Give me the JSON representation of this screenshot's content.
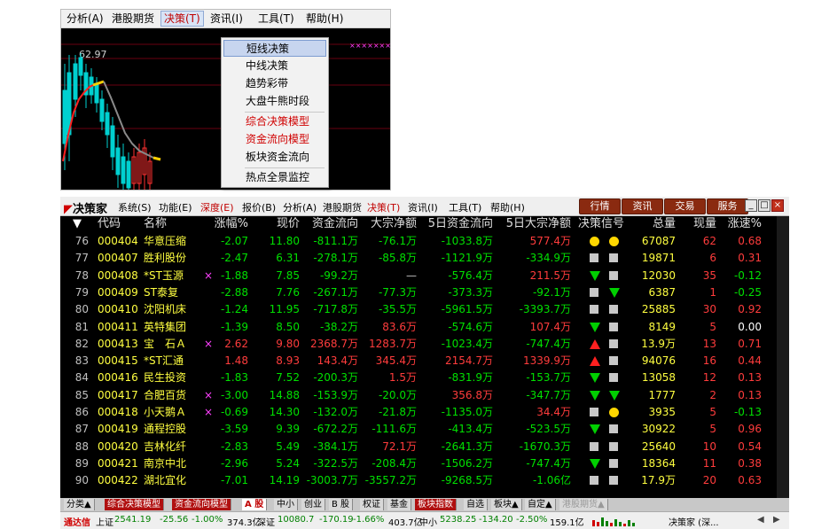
{
  "top_window": {
    "menu": [
      "分析(A)",
      "港股期货",
      "决策(T)",
      "资讯(I)",
      "工具(T)",
      "帮助(H)"
    ],
    "price_label": "62.97",
    "dropdown": [
      {
        "label": "短线决策"
      },
      {
        "label": "中线决策"
      },
      {
        "label": "趋势彩带"
      },
      {
        "label": "大盘牛熊时段"
      },
      {
        "label": "综合决策模型"
      },
      {
        "label": "资金流向模型"
      },
      {
        "label": "板块资金流向"
      },
      {
        "label": "热点全景监控"
      }
    ]
  },
  "main_window": {
    "logo": "决策家",
    "menu": [
      "系统(S)",
      "功能(E)",
      "深度(E)",
      "报价(B)",
      "分析(A)",
      "港股期货",
      "决策(T)",
      "资讯(I)",
      "工具(T)",
      "帮助(H)"
    ],
    "buttons": [
      "行情",
      "资讯",
      "交易",
      "服务"
    ],
    "window_controls": [
      "_",
      "□",
      "×"
    ],
    "headers": [
      "代码",
      "名称",
      "涨幅%",
      "现价",
      "资金流向",
      "大宗净额",
      "5日资金流向",
      "5日大宗净额",
      "决策信号",
      "总量",
      "现量",
      "涨速%"
    ],
    "rows": [
      {
        "no": "76",
        "code": "000404",
        "name": "华意压缩",
        "x": "",
        "chg": "-2.07",
        "price": "11.80",
        "flow": "-811.1万",
        "block": "-76.1万",
        "flow5": "-1033.8万",
        "block5": "577.4万",
        "sig": [
          "circ",
          "circ"
        ],
        "vol": "67087",
        "cur": "62",
        "spd": "0.68"
      },
      {
        "no": "77",
        "code": "000407",
        "name": "胜利股份",
        "x": "",
        "chg": "-2.47",
        "price": "6.31",
        "flow": "-278.1万",
        "block": "-85.8万",
        "flow5": "-1121.9万",
        "block5": "-334.9万",
        "sig": [
          "sq",
          "sq"
        ],
        "vol": "19871",
        "cur": "6",
        "spd": "0.31"
      },
      {
        "no": "78",
        "code": "000408",
        "name": "*ST玉源",
        "x": "×",
        "chg": "-1.88",
        "price": "7.85",
        "flow": "-99.2万",
        "block": "—",
        "flow5": "-576.4万",
        "block5": "211.5万",
        "sig": [
          "dn",
          "sq"
        ],
        "vol": "12030",
        "cur": "35",
        "spd": "-0.12"
      },
      {
        "no": "79",
        "code": "000409",
        "name": "ST泰复",
        "x": "",
        "chg": "-2.88",
        "price": "7.76",
        "flow": "-267.1万",
        "block": "-77.3万",
        "flow5": "-373.3万",
        "block5": "-92.1万",
        "sig": [
          "sq",
          "dn"
        ],
        "vol": "6387",
        "cur": "1",
        "spd": "-0.25"
      },
      {
        "no": "80",
        "code": "000410",
        "name": "沈阳机床",
        "x": "",
        "chg": "-1.24",
        "price": "11.95",
        "flow": "-717.8万",
        "block": "-35.5万",
        "flow5": "-5961.5万",
        "block5": "-3393.7万",
        "sig": [
          "sq",
          "sq"
        ],
        "vol": "25885",
        "cur": "30",
        "spd": "0.92"
      },
      {
        "no": "81",
        "code": "000411",
        "name": "英特集团",
        "x": "",
        "chg": "-1.39",
        "price": "8.50",
        "flow": "-38.2万",
        "block": "83.6万",
        "flow5": "-574.6万",
        "block5": "107.4万",
        "sig": [
          "dn",
          "sq"
        ],
        "vol": "8149",
        "cur": "5",
        "spd": "0.00"
      },
      {
        "no": "82",
        "code": "000413",
        "name": "宝　石Ａ",
        "x": "×",
        "chg": "2.62",
        "price": "9.80",
        "flow": "2368.7万",
        "block": "1283.7万",
        "flow5": "-1023.4万",
        "block5": "-747.4万",
        "sig": [
          "up",
          "sq"
        ],
        "vol": "13.9万",
        "cur": "13",
        "spd": "0.71"
      },
      {
        "no": "83",
        "code": "000415",
        "name": "*ST汇通",
        "x": "",
        "chg": "1.48",
        "price": "8.93",
        "flow": "143.4万",
        "block": "345.4万",
        "flow5": "2154.7万",
        "block5": "1339.9万",
        "sig": [
          "up",
          "sq"
        ],
        "vol": "94076",
        "cur": "16",
        "spd": "0.44"
      },
      {
        "no": "84",
        "code": "000416",
        "name": "民生投资",
        "x": "",
        "chg": "-1.83",
        "price": "7.52",
        "flow": "-200.3万",
        "block": "1.5万",
        "flow5": "-831.9万",
        "block5": "-153.7万",
        "sig": [
          "dn",
          "sq"
        ],
        "vol": "13058",
        "cur": "12",
        "spd": "0.13"
      },
      {
        "no": "85",
        "code": "000417",
        "name": "合肥百货",
        "x": "×",
        "chg": "-3.00",
        "price": "14.88",
        "flow": "-153.9万",
        "block": "-20.0万",
        "flow5": "356.8万",
        "block5": "-347.7万",
        "sig": [
          "dn",
          "dn"
        ],
        "vol": "1777",
        "cur": "2",
        "spd": "0.13"
      },
      {
        "no": "86",
        "code": "000418",
        "name": "小天鹅Ａ",
        "x": "×",
        "chg": "-0.69",
        "price": "14.30",
        "flow": "-132.0万",
        "block": "-21.8万",
        "flow5": "-1135.0万",
        "block5": "34.4万",
        "sig": [
          "sq",
          "circ"
        ],
        "vol": "3935",
        "cur": "5",
        "spd": "-0.13"
      },
      {
        "no": "87",
        "code": "000419",
        "name": "通程控股",
        "x": "",
        "chg": "-3.59",
        "price": "9.39",
        "flow": "-672.2万",
        "block": "-111.6万",
        "flow5": "-413.4万",
        "block5": "-523.5万",
        "sig": [
          "dn",
          "sq"
        ],
        "vol": "30922",
        "cur": "5",
        "spd": "0.96"
      },
      {
        "no": "88",
        "code": "000420",
        "name": "吉林化纤",
        "x": "",
        "chg": "-2.83",
        "price": "5.49",
        "flow": "-384.1万",
        "block": "72.1万",
        "flow5": "-2641.3万",
        "block5": "-1670.3万",
        "sig": [
          "sq",
          "sq"
        ],
        "vol": "25640",
        "cur": "10",
        "spd": "0.54"
      },
      {
        "no": "89",
        "code": "000421",
        "name": "南京中北",
        "x": "",
        "chg": "-2.96",
        "price": "5.24",
        "flow": "-322.5万",
        "block": "-208.4万",
        "flow5": "-1506.2万",
        "block5": "-747.4万",
        "sig": [
          "dn",
          "sq"
        ],
        "vol": "18364",
        "cur": "11",
        "spd": "0.38"
      },
      {
        "no": "90",
        "code": "000422",
        "name": "湖北宜化",
        "x": "",
        "chg": "-7.01",
        "price": "14.19",
        "flow": "-3003.7万",
        "block": "-3557.2万",
        "flow5": "-9268.5万",
        "block5": "-1.06亿",
        "sig": [
          "sq",
          "sq"
        ],
        "vol": "17.9万",
        "cur": "20",
        "spd": "0.63"
      }
    ],
    "tabs": [
      "分类▲",
      "综合决策模型",
      "资金流向模型",
      "A 股",
      "中小",
      "创业",
      "B 股",
      "权证",
      "基金",
      "板块指数",
      "自选",
      "板块▲",
      "自定▲",
      "港股期货▲"
    ],
    "status": {
      "brand": "通达信",
      "sh_label": "上证",
      "sh_index": "2541.19",
      "sh_chg": "-25.56",
      "sh_pct": "-1.00%",
      "sh_amt": "374.3亿",
      "sz_label": "深证",
      "sz_index": "10080.7",
      "sz_chg": "-170.19",
      "sz_pct": "-1.66%",
      "sz_amt": "403.7亿",
      "zx_label": "中小",
      "zx_index": "5238.25",
      "zx_chg": "-134.20",
      "zx_pct": "-2.50%",
      "zx_amt": "159.1亿",
      "right": "决策家 (深..."
    }
  }
}
